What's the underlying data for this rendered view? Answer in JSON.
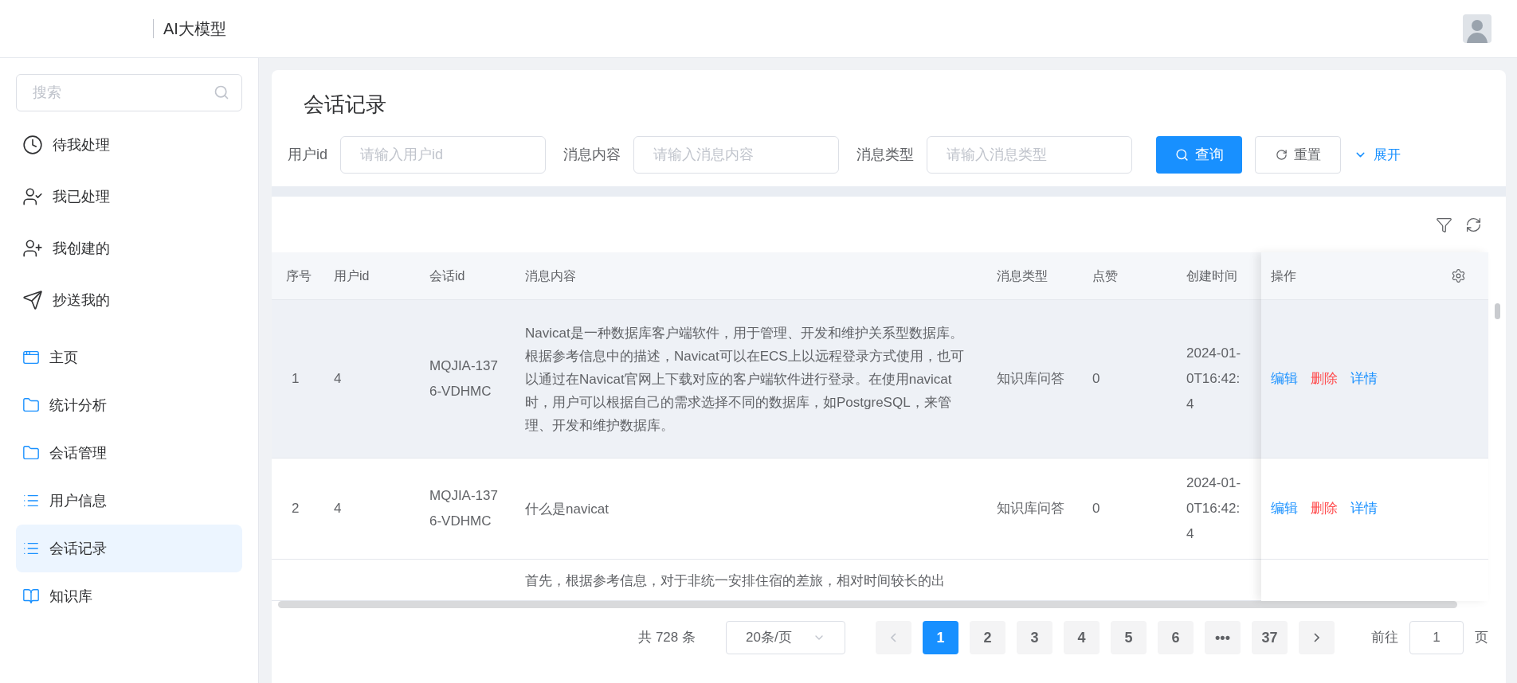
{
  "header": {
    "title": "AI大模型"
  },
  "sidebar": {
    "search": {
      "placeholder": "搜索"
    },
    "tasks": [
      {
        "label": "待我处理",
        "kind": "clock",
        "selected": false
      },
      {
        "label": "我已处理",
        "kind": "user-check",
        "selected": false
      },
      {
        "label": "我创建的",
        "kind": "user-plus",
        "selected": false
      },
      {
        "label": "抄送我的",
        "kind": "send",
        "selected": false
      }
    ],
    "menu": [
      {
        "label": "主页",
        "kind": "window",
        "selected": false
      },
      {
        "label": "统计分析",
        "kind": "folder",
        "selected": false
      },
      {
        "label": "会话管理",
        "kind": "folder",
        "selected": false
      },
      {
        "label": "用户信息",
        "kind": "list",
        "selected": false
      },
      {
        "label": "会话记录",
        "kind": "list",
        "selected": true
      },
      {
        "label": "知识库",
        "kind": "book",
        "selected": false
      }
    ]
  },
  "page": {
    "title": "会话记录",
    "filters": [
      {
        "label": "用户id",
        "placeholder": "请输入用户id"
      },
      {
        "label": "消息内容",
        "placeholder": "请输入消息内容"
      },
      {
        "label": "消息类型",
        "placeholder": "请输入消息类型"
      }
    ],
    "buttons": {
      "search": "查询",
      "reset": "重置",
      "expand": "展开"
    },
    "table": {
      "columns": [
        "序号",
        "用户id",
        "会话id",
        "消息内容",
        "消息类型",
        "点赞",
        "创建时间"
      ],
      "action_column": "操作",
      "rows": [
        {
          "index": "1",
          "user_id": "4",
          "session_id": "MQJIA-1376-VDHMC",
          "content": "Navicat是一种数据库客户端软件，用于管理、开发和维护关系型数据库。根据参考信息中的描述，Navicat可以在ECS上以远程登录方式使用，也可以通过在Navicat官网上下载对应的客户端软件进行登录。在使用navicat时，用户可以根据自己的需求选择不同的数据库，如PostgreSQL，来管理、开发和维护数据库。",
          "type": "知识库问答",
          "likes": "0",
          "created": "2024-01-\n0T16:42:\n4",
          "actions": [
            "编辑",
            "删除",
            "详情"
          ],
          "hovered": true
        },
        {
          "index": "2",
          "user_id": "4",
          "session_id": "MQJIA-1376-VDHMC",
          "content": "什么是navicat",
          "type": "知识库问答",
          "likes": "0",
          "created": "2024-01-\n0T16:42:\n4",
          "actions": [
            "编辑",
            "删除",
            "详情"
          ],
          "hovered": false
        },
        {
          "content": "首先，根据参考信息，对于非统一安排住宿的差旅，相对时间较长的出",
          "actions": [],
          "hovered": false
        }
      ]
    },
    "pagination": {
      "total": "共 728 条",
      "page_size": "20条/页",
      "pages": [
        {
          "label": "1",
          "selected": true
        },
        {
          "label": "2",
          "selected": false
        },
        {
          "label": "3",
          "selected": false
        },
        {
          "label": "4",
          "selected": false
        },
        {
          "label": "5",
          "selected": false
        },
        {
          "label": "6",
          "selected": false
        },
        {
          "label": "•••",
          "selected": false
        },
        {
          "label": "37",
          "selected": false
        }
      ],
      "goto_label": "前往",
      "goto_value": "1",
      "goto_suffix": "页"
    }
  }
}
